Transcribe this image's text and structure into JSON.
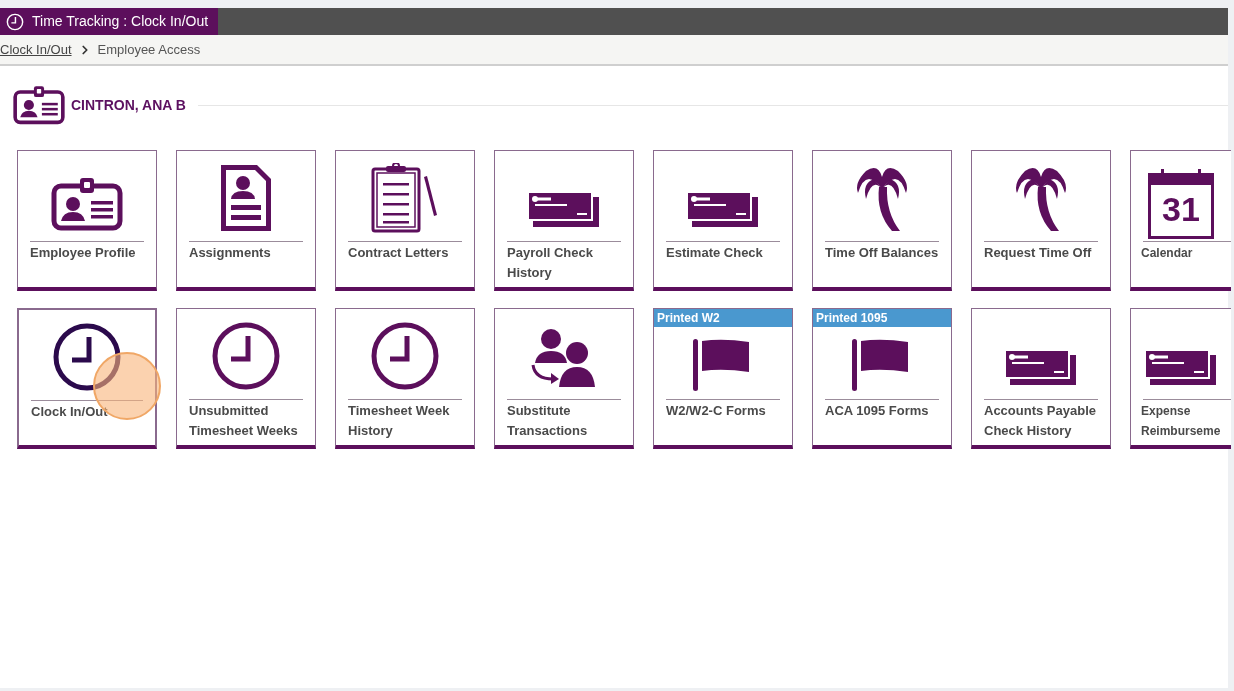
{
  "window": {
    "title": "Time Tracking : Clock In/Out"
  },
  "breadcrumb": [
    {
      "label": "Clock In/Out",
      "kind": "link"
    },
    {
      "label": "Employee Access",
      "kind": "current"
    }
  ],
  "employee": {
    "name": "CINTRON, ANA B"
  },
  "tiles": [
    {
      "label": "Employee Profile",
      "kind": "idcard",
      "selected": false,
      "clicked": false
    },
    {
      "label": "Assignments",
      "kind": "document",
      "selected": false,
      "clicked": false
    },
    {
      "label": "Contract Letters",
      "kind": "clipboard",
      "selected": false,
      "clicked": false
    },
    {
      "label": "Payroll Check History",
      "kind": "check",
      "selected": false,
      "clicked": false
    },
    {
      "label": "Estimate Check",
      "kind": "check",
      "selected": false,
      "clicked": false
    },
    {
      "label": "Time Off Balances",
      "kind": "palm",
      "selected": false,
      "clicked": false
    },
    {
      "label": "Request Time Off",
      "kind": "palm",
      "selected": false,
      "clicked": false
    },
    {
      "label": "Calendar",
      "kind": "calendar",
      "icon_text": "31",
      "selected": false,
      "clicked": false
    },
    {
      "label": "Clock In/Out",
      "kind": "clock",
      "selected": true,
      "clicked": true
    },
    {
      "label": "Unsubmitted Timesheet Weeks",
      "kind": "clock",
      "selected": false,
      "clicked": false
    },
    {
      "label": "Timesheet Week History",
      "kind": "clock",
      "selected": false,
      "clicked": false
    },
    {
      "label": "Substitute Transactions",
      "kind": "people",
      "selected": false,
      "clicked": false
    },
    {
      "label": "W2/W2-C Forms",
      "kind": "flag",
      "badge": "Printed W2",
      "selected": false,
      "clicked": false
    },
    {
      "label": "ACA 1095 Forms",
      "kind": "flag",
      "badge": "Printed 1095",
      "selected": false,
      "clicked": false
    },
    {
      "label": "Accounts Payable Check History",
      "kind": "check",
      "selected": false,
      "clicked": false
    },
    {
      "label": "Expense Reimburseme",
      "kind": "check",
      "selected": false,
      "clicked": false
    }
  ]
}
